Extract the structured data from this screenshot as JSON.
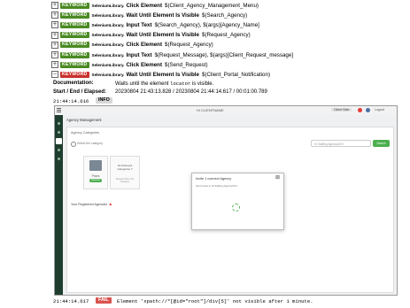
{
  "keywords": [
    {
      "type": "KEYWORD",
      "library": "SeleniumLibrary.",
      "name": "Click Element",
      "args": "$(Client_Agency_Management_Menu)",
      "status": "pass",
      "expander": "+"
    },
    {
      "type": "KEYWORD",
      "library": "SeleniumLibrary.",
      "name": "Wait Until Element Is Visible",
      "args": "$(Search_Agency)",
      "status": "pass",
      "expander": "+"
    },
    {
      "type": "KEYWORD",
      "library": "SeleniumLibrary.",
      "name": "Input Text",
      "args": "$(Search_Agency), $(args)[Agency_Name]",
      "status": "pass",
      "expander": "+"
    },
    {
      "type": "KEYWORD",
      "library": "SeleniumLibrary.",
      "name": "Wait Until Element Is Visible",
      "args": "$(Request_Agency)",
      "status": "pass",
      "expander": "+"
    },
    {
      "type": "KEYWORD",
      "library": "SeleniumLibrary.",
      "name": "Click Element",
      "args": "$(Request_Agency)",
      "status": "pass",
      "expander": "+"
    },
    {
      "type": "KEYWORD",
      "library": "SeleniumLibrary.",
      "name": "Input Text",
      "args": "$(Request_Message), $(args)[Client_Request_message]",
      "status": "pass",
      "expander": "+"
    },
    {
      "type": "KEYWORD",
      "library": "SeleniumLibrary.",
      "name": "Click Element",
      "args": "$(Send_Request)",
      "status": "pass",
      "expander": "+"
    },
    {
      "type": "KEYWORD",
      "library": "SeleniumLibrary.",
      "name": "Wait Until Element Is Visible",
      "args": "$(Client_Portal_Notification)",
      "status": "fail",
      "expander": "−"
    }
  ],
  "documentation": {
    "label": "Documentation:",
    "text_before": "Waits until the element ",
    "code": "locator",
    "text_after": " is visible."
  },
  "elapsed": {
    "label": "Start / End / Elapsed:",
    "value": "20230804 21:43:13.828 / 20230804 21:44:14.617 / 00:01:00.789"
  },
  "info_line": {
    "time": "21:44:14.616",
    "level": "INFO"
  },
  "fail_line": {
    "time": "21:44:14.617",
    "level": "FAIL",
    "message": "Element 'xpath://*[@id=\"root\"]/div[5]' not visible after 1 minute."
  },
  "screenshot": {
    "top_center": "Hi CLIENTNAME",
    "top_right_pill": "Client Side",
    "top_right_link": "Logout",
    "page_title": "Agency Management",
    "section_title": "Agency Categories",
    "filter_label": "Select the category",
    "search_placeholder": "Hi Staffing AgencyDXH",
    "search_button": "Search",
    "card_label": "Prices",
    "card_button": "Request",
    "no_relevant": "No Relevant Categories ?",
    "no_relevant_sub": "Request New Job Category",
    "registered": "Your Registered Agencies",
    "modal": {
      "title": "Invite 1 connect Agency",
      "subtitle": "Send Invite to Hi Staffing AgencyDXH",
      "close": "⊠"
    },
    "colors": {
      "sidebar": "#1e3d2e",
      "accent_green": "#4caf50",
      "badge_red": "#e53935"
    }
  },
  "colors": {
    "keyword_green": "#4a8a22",
    "keyword_red": "#c9302c",
    "info_bg": "#d8d8d8",
    "fail_bg": "#d9534f"
  }
}
